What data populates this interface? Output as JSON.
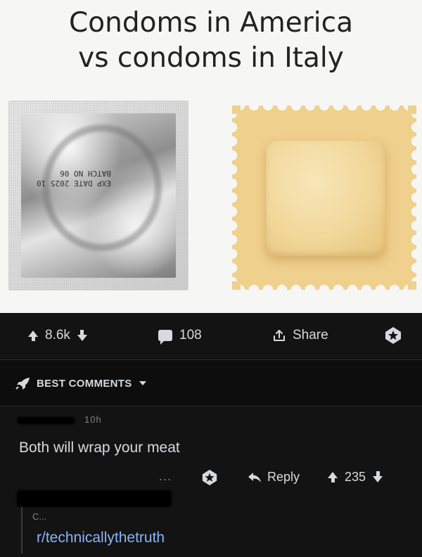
{
  "meme": {
    "title_line1": "Condoms in America",
    "title_line2": "vs condoms in Italy",
    "wrapper_print_line1": "EXP DATE 2025 10",
    "wrapper_print_line2": "BATCH NO 06"
  },
  "post_actions": {
    "upvotes": "8.6k",
    "comments": "108",
    "share_label": "Share",
    "icons": [
      "upvote-icon",
      "downvote-icon",
      "comment-icon",
      "share-icon",
      "award-icon"
    ]
  },
  "sort": {
    "label": "BEST COMMENTS",
    "icon": "rocket-icon"
  },
  "comment": {
    "time": "10h",
    "body": "Both will wrap your meat",
    "more": "...",
    "reply_label": "Reply",
    "votes": "235"
  },
  "reply": {
    "author_partial": "C...",
    "body": "r/technicallythetruth"
  },
  "colors": {
    "background": "#111112",
    "text": "#d7dadc",
    "muted": "#818384",
    "link": "#8ab4f8"
  }
}
